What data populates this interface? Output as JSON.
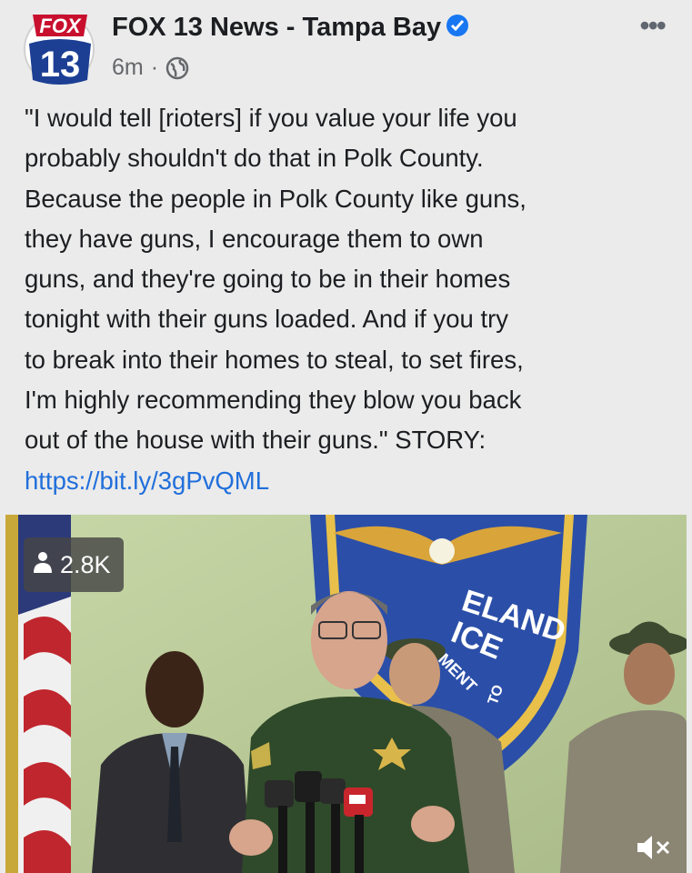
{
  "post": {
    "page_name": "FOX 13 News - Tampa Bay",
    "timestamp": "6m",
    "separator": "·",
    "more_label": "•••",
    "avatar": {
      "top_text": "FOX",
      "number": "13"
    },
    "text_lines": [
      "\"I would tell [rioters] if you value your life you",
      "probably shouldn't do that in Polk County.",
      "Because the people in Polk County like guns,",
      "they have guns, I encourage them to own",
      "guns, and they're going to be in their homes",
      "tonight with their guns loaded. And if you try",
      "to break into their homes to steal, to set fires,",
      "I'm highly recommending they blow you back",
      "out of the house with their guns.\" STORY:"
    ],
    "link": "https://bit.ly/3gPvQML"
  },
  "video": {
    "viewer_count": "2.8K",
    "seal_text_line1": "ELAND",
    "seal_text_line2": "ICE",
    "seal_text_line3": "MENT",
    "seal_text_line4": "TO"
  },
  "colors": {
    "background": "#ebebeb",
    "text": "#1c1e21",
    "link": "#216fdb",
    "verified": "#1877f2",
    "sheriff_green": "#2f4a2a"
  }
}
